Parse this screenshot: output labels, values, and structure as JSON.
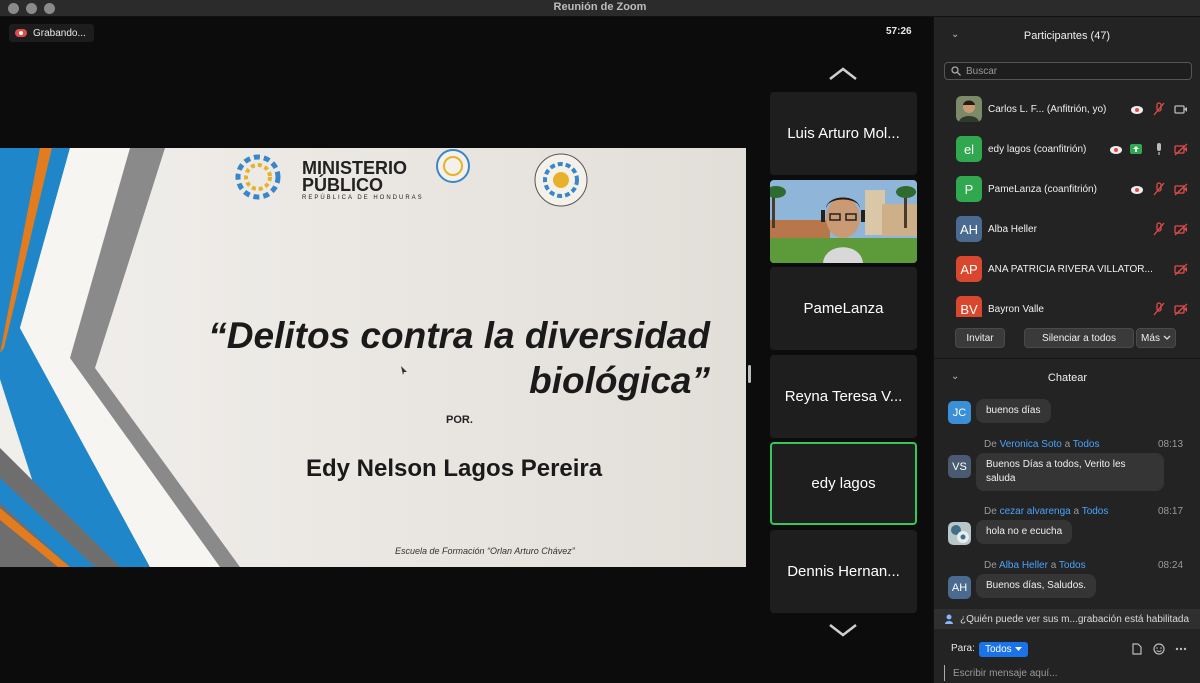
{
  "window": {
    "title": "Reunión de Zoom"
  },
  "recording": {
    "label": "Grabando..."
  },
  "timer": "57:26",
  "slide": {
    "logo_line1": "MINISTERIO",
    "logo_line2": "PÚBLICO",
    "logo_sub": "REPÚBLICA DE HONDURAS",
    "title_line1": "“Delitos contra la diversidad",
    "title_line2": "biológica”",
    "por": "POR.",
    "author": "Edy Nelson Lagos Pereira",
    "footer": "Escuela de Formación “Orlan Arturo Chávez”"
  },
  "gallery": {
    "tiles": [
      {
        "label": "Luis Arturo Mol..."
      },
      {
        "label": ""
      },
      {
        "label": "PameLanza"
      },
      {
        "label": "Reyna Teresa V..."
      },
      {
        "label": "edy lagos",
        "active": true
      },
      {
        "label": "Dennis Hernan..."
      }
    ]
  },
  "participants": {
    "header": "Participantes (47)",
    "search_placeholder": "Buscar",
    "list": [
      {
        "initials": "",
        "name": "Carlos L. F...   (Anfitrión, yo)",
        "color": "#6b6b6b"
      },
      {
        "initials": "el",
        "name": "edy lagos (coanfitrión)",
        "color": "#2fa84f"
      },
      {
        "initials": "P",
        "name": "PameLanza (coanfitrión)",
        "color": "#2fa84f"
      },
      {
        "initials": "AH",
        "name": "Alba Heller",
        "color": "#4a6b8f"
      },
      {
        "initials": "AP",
        "name": "ANA PATRICIA RIVERA VILLATOR...",
        "color": "#d9482e"
      },
      {
        "initials": "BV",
        "name": "Bayron Valle",
        "color": "#d9482e"
      }
    ],
    "buttons": {
      "invite": "Invitar",
      "mute_all": "Silenciar a todos",
      "more": "Más"
    }
  },
  "chat": {
    "header": "Chatear",
    "from_word": "De",
    "to_word": "a",
    "messages": [
      {
        "initials": "JC",
        "color": "#3a8fd6",
        "text": "buenos días"
      },
      {
        "from": "Veronica Soto",
        "to": "Todos",
        "time": "08:13",
        "initials": "VS",
        "color": "#4a5a70",
        "text_line1": "Buenos Días a todos, Verito les",
        "text_line2": "saluda"
      },
      {
        "from": "cezar alvarenga",
        "to": "Todos",
        "time": "08:17",
        "initials": "",
        "color": "#8aa0a8",
        "text": "hola no e ecucha"
      },
      {
        "from": "Alba Heller",
        "to": "Todos",
        "time": "08:24",
        "initials": "AH",
        "color": "#4a6b8f",
        "text": "Buenos días, Saludos."
      }
    ],
    "notice": "¿Quién puede ver sus m...grabación está habilitada",
    "to_label": "Para:",
    "to_value": "Todos",
    "input_placeholder": "Escribir mensaje aquí..."
  }
}
